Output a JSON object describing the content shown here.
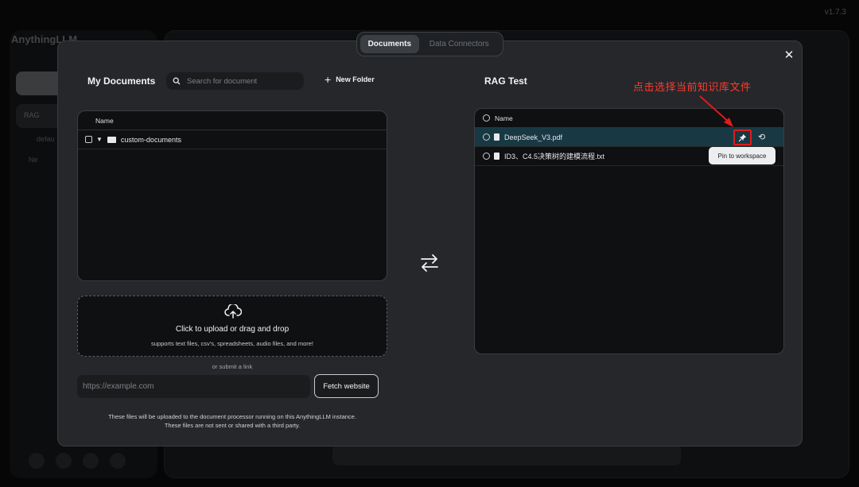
{
  "app": {
    "version": "v1.7.3",
    "name": "AnythingLLM",
    "background_workspace_label": "RAG",
    "background_thread_label": "defau",
    "background_new_thread_label": "Ne"
  },
  "tabs": [
    {
      "label": "Documents",
      "active": true
    },
    {
      "label": "Data Connectors",
      "active": false
    }
  ],
  "my_documents": {
    "title": "My Documents",
    "search_placeholder": "Search for document",
    "new_folder_label": "New Folder",
    "column_name": "Name",
    "folders": [
      {
        "name": "custom-documents",
        "expanded": true
      }
    ]
  },
  "upload": {
    "main_text": "Click to upload or drag and drop",
    "sub_text": "supports text files, csv's, spreadsheets, audio files, and more!",
    "or_link_text": "or submit a link",
    "url_placeholder": "https://example.com",
    "fetch_label": "Fetch website",
    "disclaimer_line1": "These files will be uploaded to the document processor running on this AnythingLLM instance.",
    "disclaimer_line2": "These files are not sent or shared with a third party."
  },
  "workspace": {
    "title": "RAG Test",
    "column_name": "Name",
    "files": [
      {
        "name": "DeepSeek_V3.pdf",
        "highlighted": true
      },
      {
        "name": "ID3、C4.5决策树的建模流程.txt",
        "highlighted": false
      }
    ],
    "pin_tooltip": "Pin to workspace"
  },
  "annotation": {
    "text": "点击选择当前知识库文件",
    "color": "#ff3b2f"
  },
  "icons": {
    "close": "close-icon",
    "search": "search-icon",
    "plus": "plus-icon",
    "folder": "folder-icon",
    "file": "file-icon",
    "pin": "pin-icon",
    "undo": "undo-icon",
    "transfer": "transfer-arrows-icon",
    "upload": "cloud-upload-icon"
  },
  "colors": {
    "highlight_row": "#183944",
    "annotation_red": "#e01b1b"
  }
}
